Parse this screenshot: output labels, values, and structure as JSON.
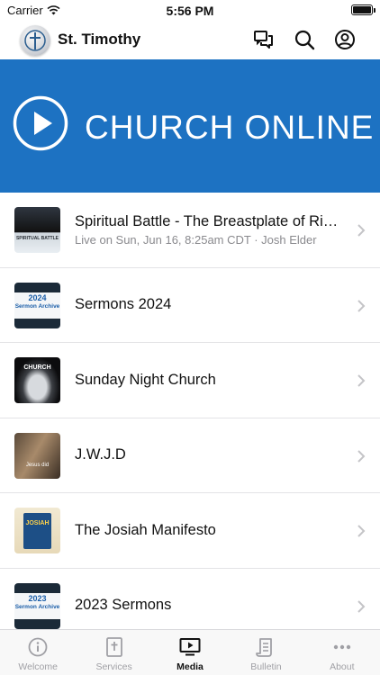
{
  "status_bar": {
    "carrier": "Carrier",
    "time": "5:56 PM"
  },
  "header": {
    "title": "St. Timothy",
    "icons": [
      "chat-bubbles-icon",
      "search-icon",
      "profile-icon"
    ]
  },
  "hero": {
    "title": "CHURCH ONLINE"
  },
  "media_items": [
    {
      "title": "Spiritual Battle - The Breastplate of Righteousness",
      "subtitle": "Live on Sun, Jun 16, 8:25am CDT · Josh Elder"
    },
    {
      "title": "Sermons 2024",
      "subtitle": ""
    },
    {
      "title": "Sunday Night Church",
      "subtitle": ""
    },
    {
      "title": "J.W.J.D",
      "subtitle": ""
    },
    {
      "title": "The Josiah Manifesto",
      "subtitle": ""
    },
    {
      "title": "2023 Sermons",
      "subtitle": ""
    }
  ],
  "thumb_labels": {
    "t1": "SPIRITUAL BATTLE",
    "t2_year": "2024",
    "t2_line": "Sermon Archive",
    "t3": "CHURCH",
    "t4": "Jesus did",
    "t5": "JOSIAH",
    "t6_year": "2023",
    "t6_line": "Sermon Archive"
  },
  "tabs": [
    {
      "label": "Welcome",
      "icon": "info-icon",
      "active": false
    },
    {
      "label": "Services",
      "icon": "bible-icon",
      "active": false
    },
    {
      "label": "Media",
      "icon": "play-screen-icon",
      "active": true
    },
    {
      "label": "Bulletin",
      "icon": "scroll-icon",
      "active": false
    },
    {
      "label": "About",
      "icon": "more-dots-icon",
      "active": false
    }
  ],
  "colors": {
    "hero_blue": "#1d72c2",
    "tab_inactive": "#a0a0a5"
  }
}
